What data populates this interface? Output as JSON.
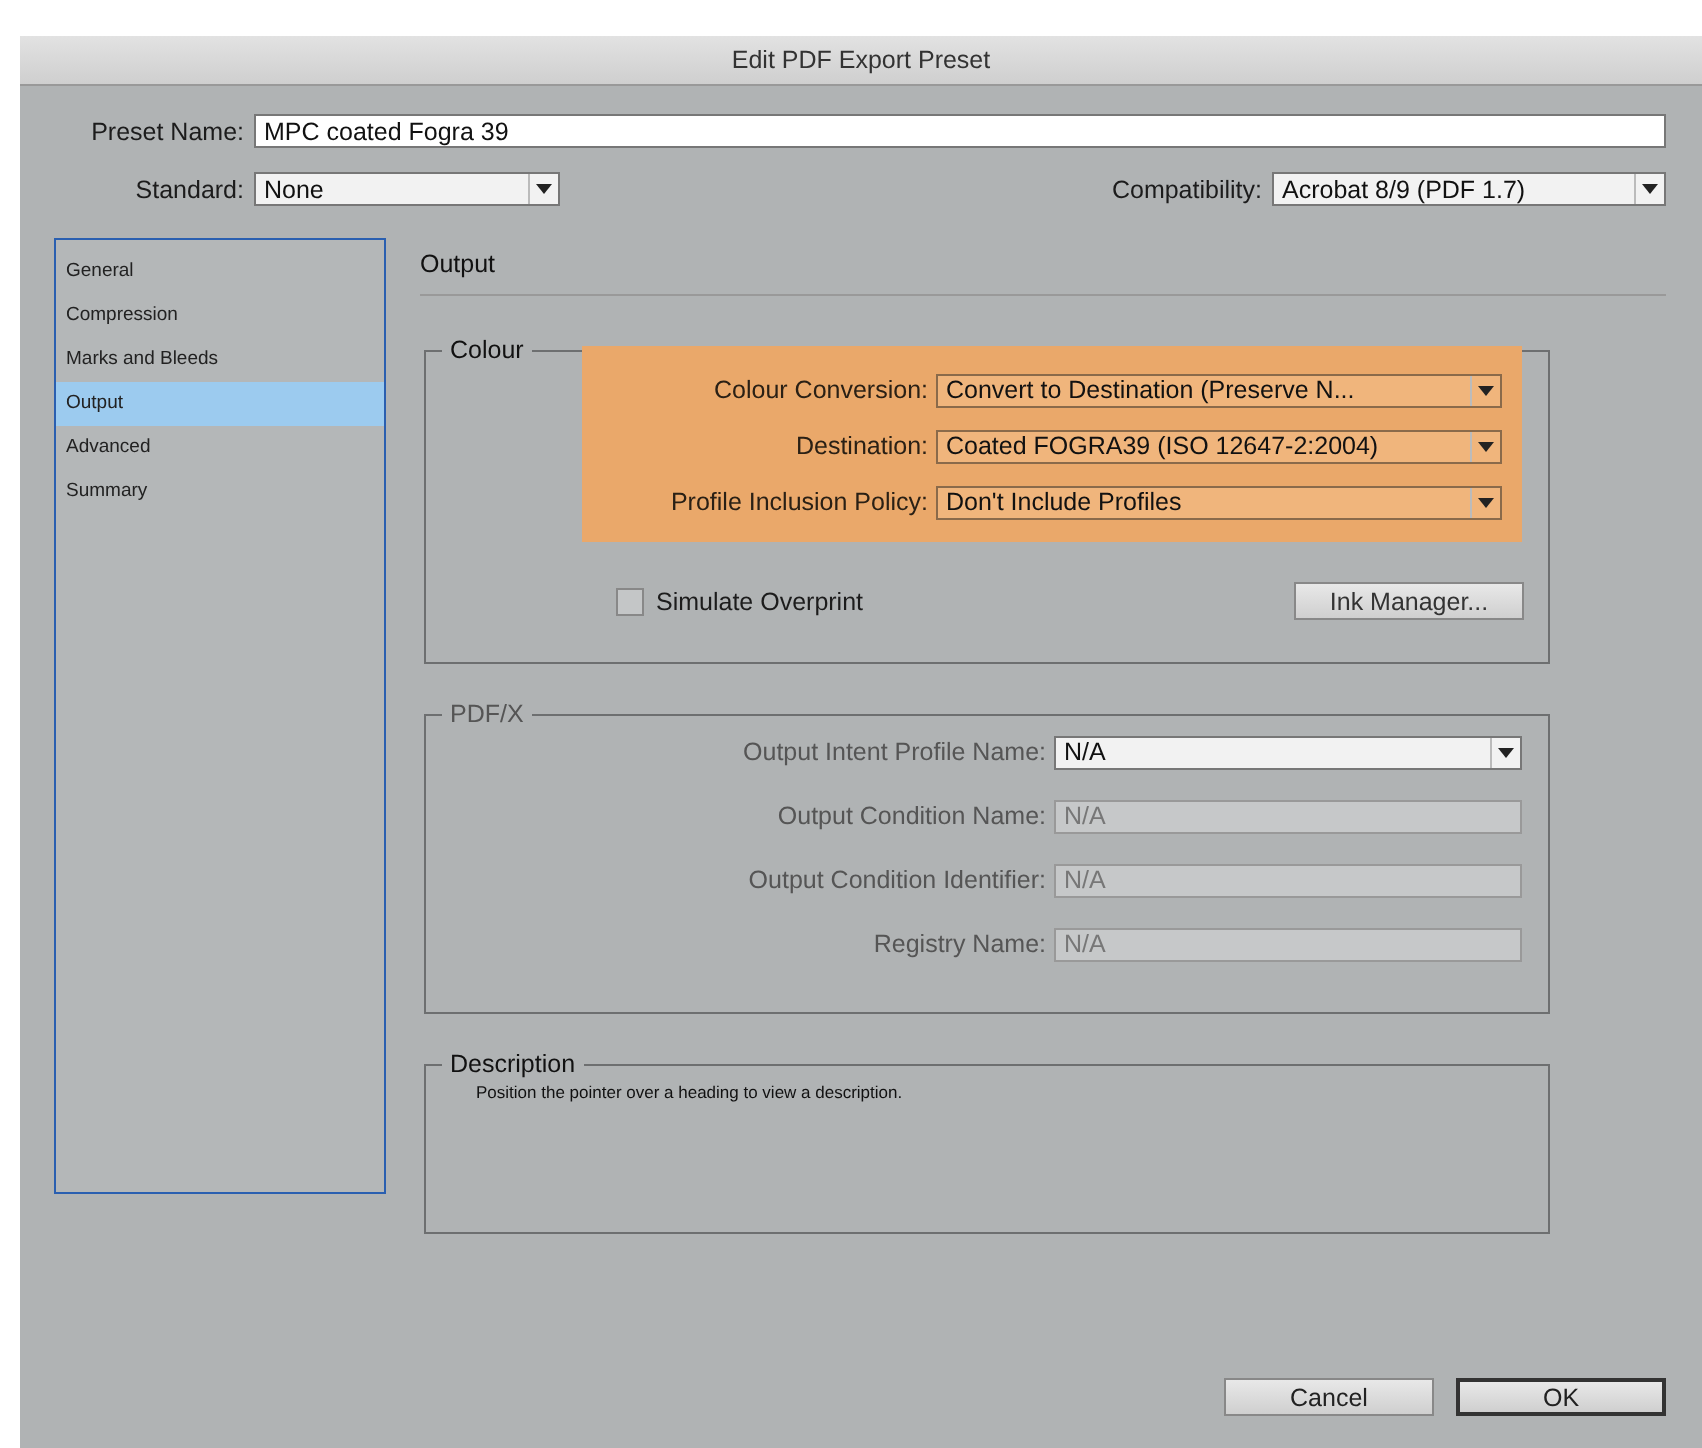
{
  "window": {
    "title": "Edit PDF Export Preset"
  },
  "preset_name": {
    "label": "Preset Name:",
    "value": "MPC coated Fogra 39"
  },
  "standard": {
    "label": "Standard:",
    "value": "None"
  },
  "compatibility": {
    "label": "Compatibility:",
    "value": "Acrobat 8/9 (PDF 1.7)"
  },
  "sidebar": {
    "items": [
      {
        "label": "General",
        "selected": false
      },
      {
        "label": "Compression",
        "selected": false
      },
      {
        "label": "Marks and Bleeds",
        "selected": false
      },
      {
        "label": "Output",
        "selected": true
      },
      {
        "label": "Advanced",
        "selected": false
      },
      {
        "label": "Summary",
        "selected": false
      }
    ]
  },
  "section_title": "Output",
  "colour": {
    "title": "Colour",
    "fields": [
      {
        "label": "Colour Conversion:",
        "value": "Convert to Destination (Preserve N...",
        "highlighted": true
      },
      {
        "label": "Destination:",
        "value": "Coated FOGRA39 (ISO 12647-2:2004)",
        "highlighted": true
      },
      {
        "label": "Profile Inclusion Policy:",
        "value": "Don't Include Profiles",
        "highlighted": true
      }
    ],
    "simulate_overprint": {
      "label": "Simulate Overprint",
      "checked": false
    },
    "ink_manager": "Ink Manager..."
  },
  "pdfx": {
    "title": "PDF/X",
    "fields": [
      {
        "kind": "dropdown",
        "label": "Output Intent Profile Name:",
        "value": "N/A",
        "disabled": false
      },
      {
        "kind": "text",
        "label": "Output Condition Name:",
        "value": "N/A",
        "disabled": true
      },
      {
        "kind": "text",
        "label": "Output Condition Identifier:",
        "value": "N/A",
        "disabled": true
      },
      {
        "kind": "text",
        "label": "Registry Name:",
        "value": "N/A",
        "disabled": true
      }
    ]
  },
  "description": {
    "title": "Description",
    "text": "Position the pointer over a heading to view a description."
  },
  "buttons": [
    {
      "label": "Cancel",
      "default": false
    },
    {
      "label": "OK",
      "default": true
    }
  ]
}
